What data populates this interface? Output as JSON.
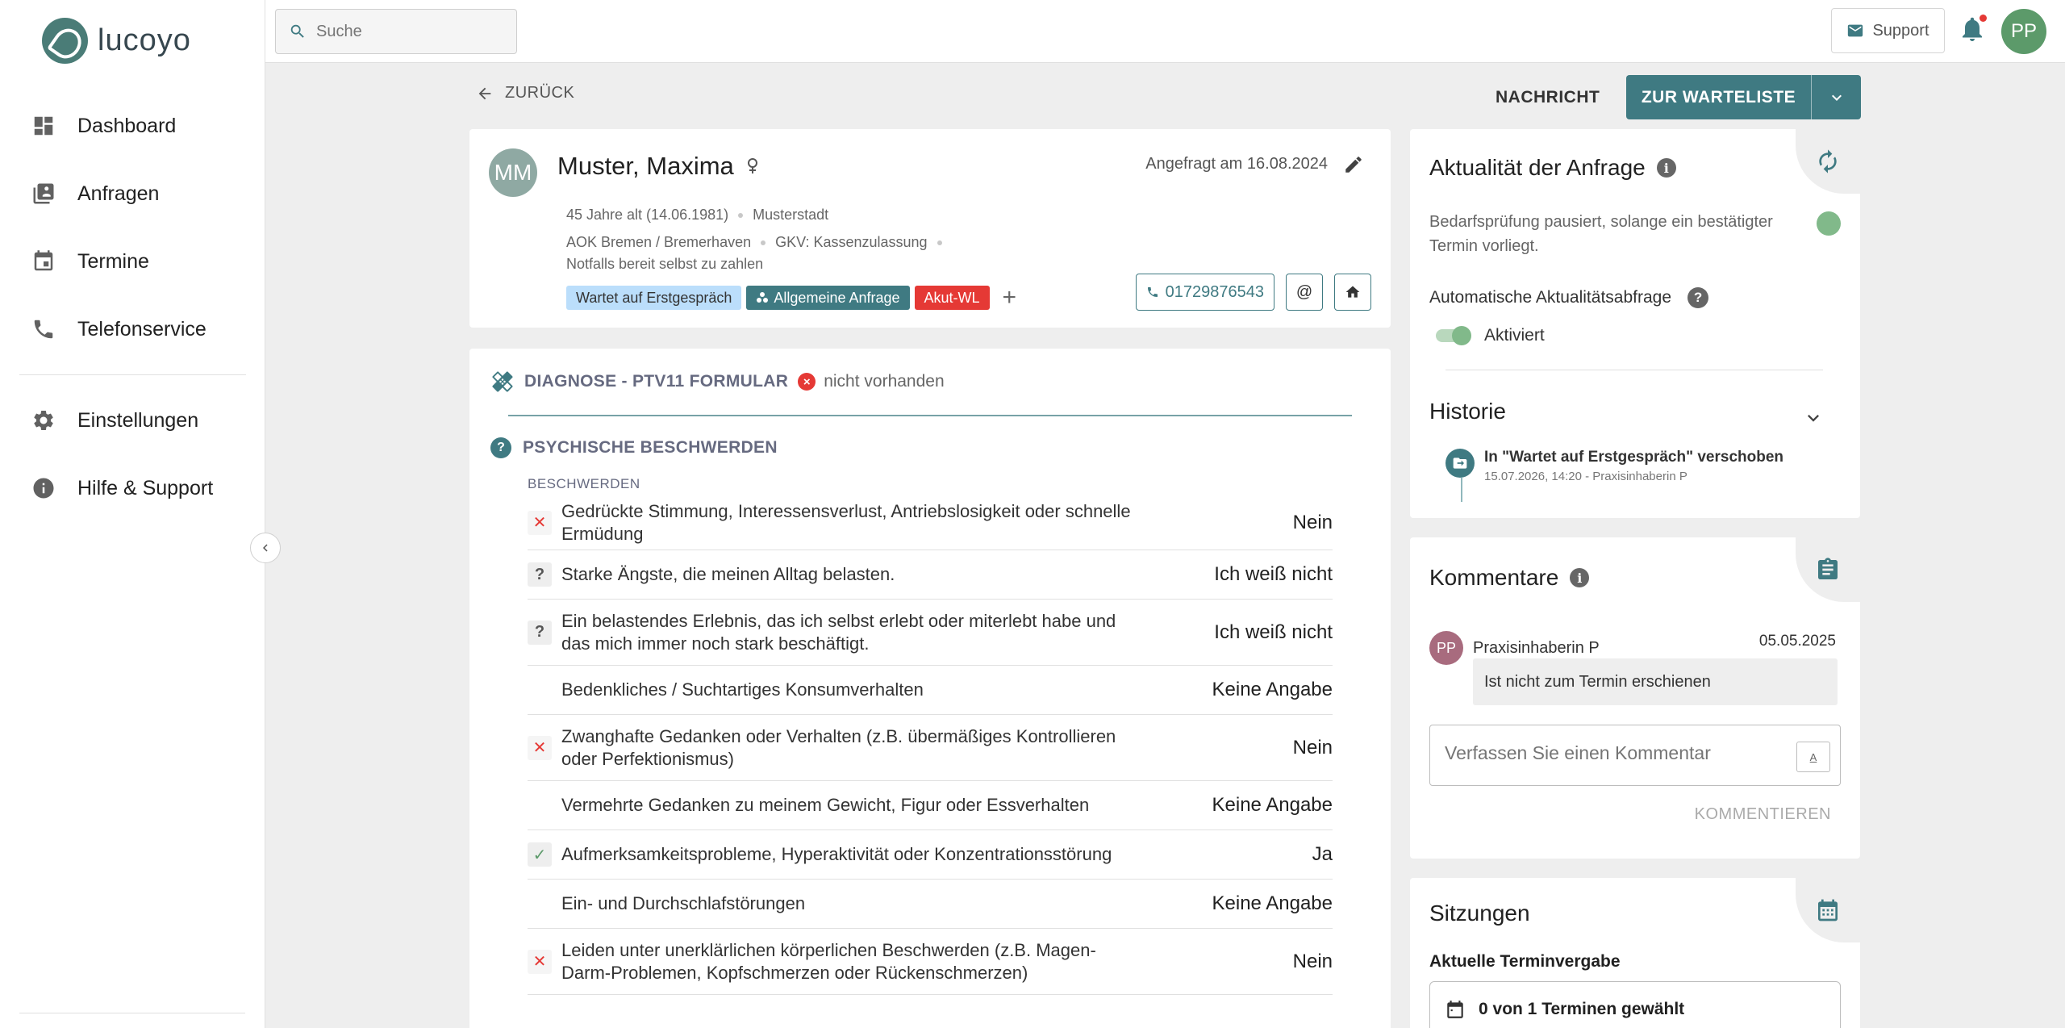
{
  "brand": {
    "name": "lucoyo",
    "color": "#4a7c77"
  },
  "sidebar": {
    "items": [
      {
        "label": "Dashboard",
        "icon": "dashboard-icon"
      },
      {
        "label": "Anfragen",
        "icon": "requests-icon"
      },
      {
        "label": "Termine",
        "icon": "calendar-icon"
      },
      {
        "label": "Telefonservice",
        "icon": "phone-icon"
      },
      {
        "label": "Einstellungen",
        "icon": "gear-icon"
      },
      {
        "label": "Hilfe & Support",
        "icon": "info-icon"
      }
    ]
  },
  "topbar": {
    "search_placeholder": "Suche",
    "support_label": "Support",
    "user_initials": "PP"
  },
  "actions": {
    "back_label": "ZURÜCK",
    "message_label": "NACHRICHT",
    "waitlist_label": "ZUR WARTELISTE",
    "primary_color": "#3f7a82"
  },
  "patient": {
    "initials": "MM",
    "name": "Muster, Maxima",
    "requested": "Angefragt am 16.08.2024",
    "age": "45 Jahre alt (14.06.1981)",
    "city": "Musterstadt",
    "insurance": "AOK Bremen / Bremerhaven",
    "gkv": "GKV: Kassenzulassung",
    "self_pay": "Notfalls bereit selbst zu zahlen",
    "tags": {
      "status": "Wartet auf Erstgespräch",
      "type": "Allgemeine Anfrage",
      "priority": "Akut-WL"
    },
    "phone": "01729876543"
  },
  "diagnosis": {
    "title": "DIAGNOSE - PTV11 FORMULAR",
    "status": "nicht vorhanden",
    "section_title": "PSYCHISCHE BESCHWERDEN",
    "sub_label": "BESCHWERDEN",
    "rows": [
      {
        "text": "Gedrückte Stimmung, Interessensverlust, Antriebslosigkeit oder schnelle Ermüdung",
        "answer": "Nein",
        "mark": "no"
      },
      {
        "text": "Starke Ängste, die meinen Alltag belasten.",
        "answer": "Ich weiß nicht",
        "mark": "unk"
      },
      {
        "text": "Ein belastendes Erlebnis, das ich selbst erlebt oder miterlebt habe und das mich immer noch stark beschäftigt.",
        "answer": "Ich weiß nicht",
        "mark": "unk"
      },
      {
        "text": "Bedenkliches / Suchtartiges Konsumverhalten",
        "answer": "Keine Angabe",
        "mark": "none"
      },
      {
        "text": "Zwanghafte Gedanken oder Verhalten (z.B. übermäßiges Kontrollieren oder Perfektionismus)",
        "answer": "Nein",
        "mark": "no"
      },
      {
        "text": "Vermehrte Gedanken zu meinem Gewicht, Figur oder Essverhalten",
        "answer": "Keine Angabe",
        "mark": "none"
      },
      {
        "text": "Aufmerksamkeitsprobleme, Hyperaktivität oder Konzentrationsstörung",
        "answer": "Ja",
        "mark": "yes"
      },
      {
        "text": "Ein- und Durchschlafstörungen",
        "answer": "Keine Angabe",
        "mark": "none"
      },
      {
        "text": "Leiden unter unerklärlichen körperlichen Beschwerden (z.B. Magen-Darm-Problemen, Kopfschmerzen oder Rückenschmerzen)",
        "answer": "Nein",
        "mark": "no"
      }
    ]
  },
  "aktualitaet": {
    "title": "Aktualität der Anfrage",
    "text": "Bedarfsprüfung pausiert, solange ein bestätigter Termin vorliegt.",
    "auto_label": "Automatische Aktualitätsabfrage",
    "toggle_label": "Aktiviert",
    "history_title": "Historie",
    "history_item_title": "In \"Wartet auf Erstgespräch\" verschoben",
    "history_item_meta": "15.07.2026, 14:20 - Praxisinhaberin P"
  },
  "kommentare": {
    "title": "Kommentare",
    "author_initials": "PP",
    "author": "Praxisinhaberin P",
    "date": "05.05.2025",
    "comment": "Ist nicht zum Termin erschienen",
    "placeholder": "Verfassen Sie einen Kommentar",
    "format_label": "A",
    "submit_label": "KOMMENTIEREN"
  },
  "sitzungen": {
    "title": "Sitzungen",
    "subtitle": "Aktuelle Terminvergabe",
    "summary": "0 von 1 Terminen gewählt"
  }
}
